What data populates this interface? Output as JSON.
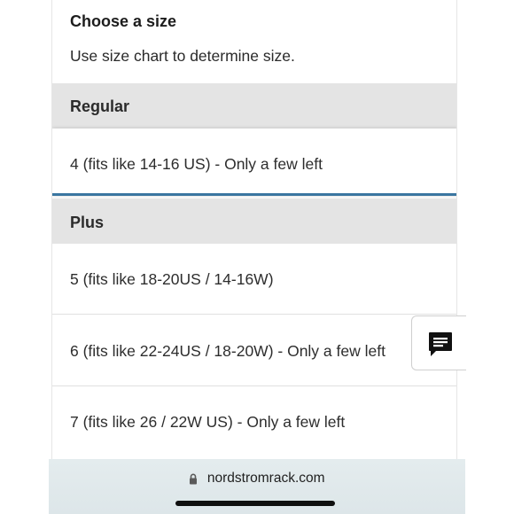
{
  "size_picker": {
    "title": "Choose a size",
    "subtitle": "Use size chart to determine size.",
    "groups": [
      {
        "label": "Regular",
        "options": [
          {
            "label": "4 (fits like 14-16 US)",
            "availability": "Only a few left"
          }
        ]
      },
      {
        "label": "Plus",
        "options": [
          {
            "label": "5 (fits like 18-20US / 14-16W)",
            "availability": ""
          },
          {
            "label": "6 (fits like 22-24US / 18-20W)",
            "availability": "Only a few left"
          },
          {
            "label": "7 (fits like 26 / 22W US)",
            "availability": "Only a few left"
          }
        ]
      }
    ],
    "option_texts": {
      "regular_4": "4 (fits like 14-16 US)  - Only a few left",
      "plus_5": "5 (fits like 18-20US / 14-16W)",
      "plus_6": "6 (fits like 22-24US / 18-20W)  - Only a few left",
      "plus_7": "7 (fits like 26 / 22W US)  - Only a few left"
    }
  },
  "chat_button": {
    "icon": "chat-bubble-icon"
  },
  "browser": {
    "url": "nordstromrack.com",
    "lock_icon": "lock-icon"
  },
  "colors": {
    "selected_underline": "#3a76a0",
    "group_header_bg": "#e4e4e4",
    "browser_bar_bg": "#e1e9ec"
  }
}
